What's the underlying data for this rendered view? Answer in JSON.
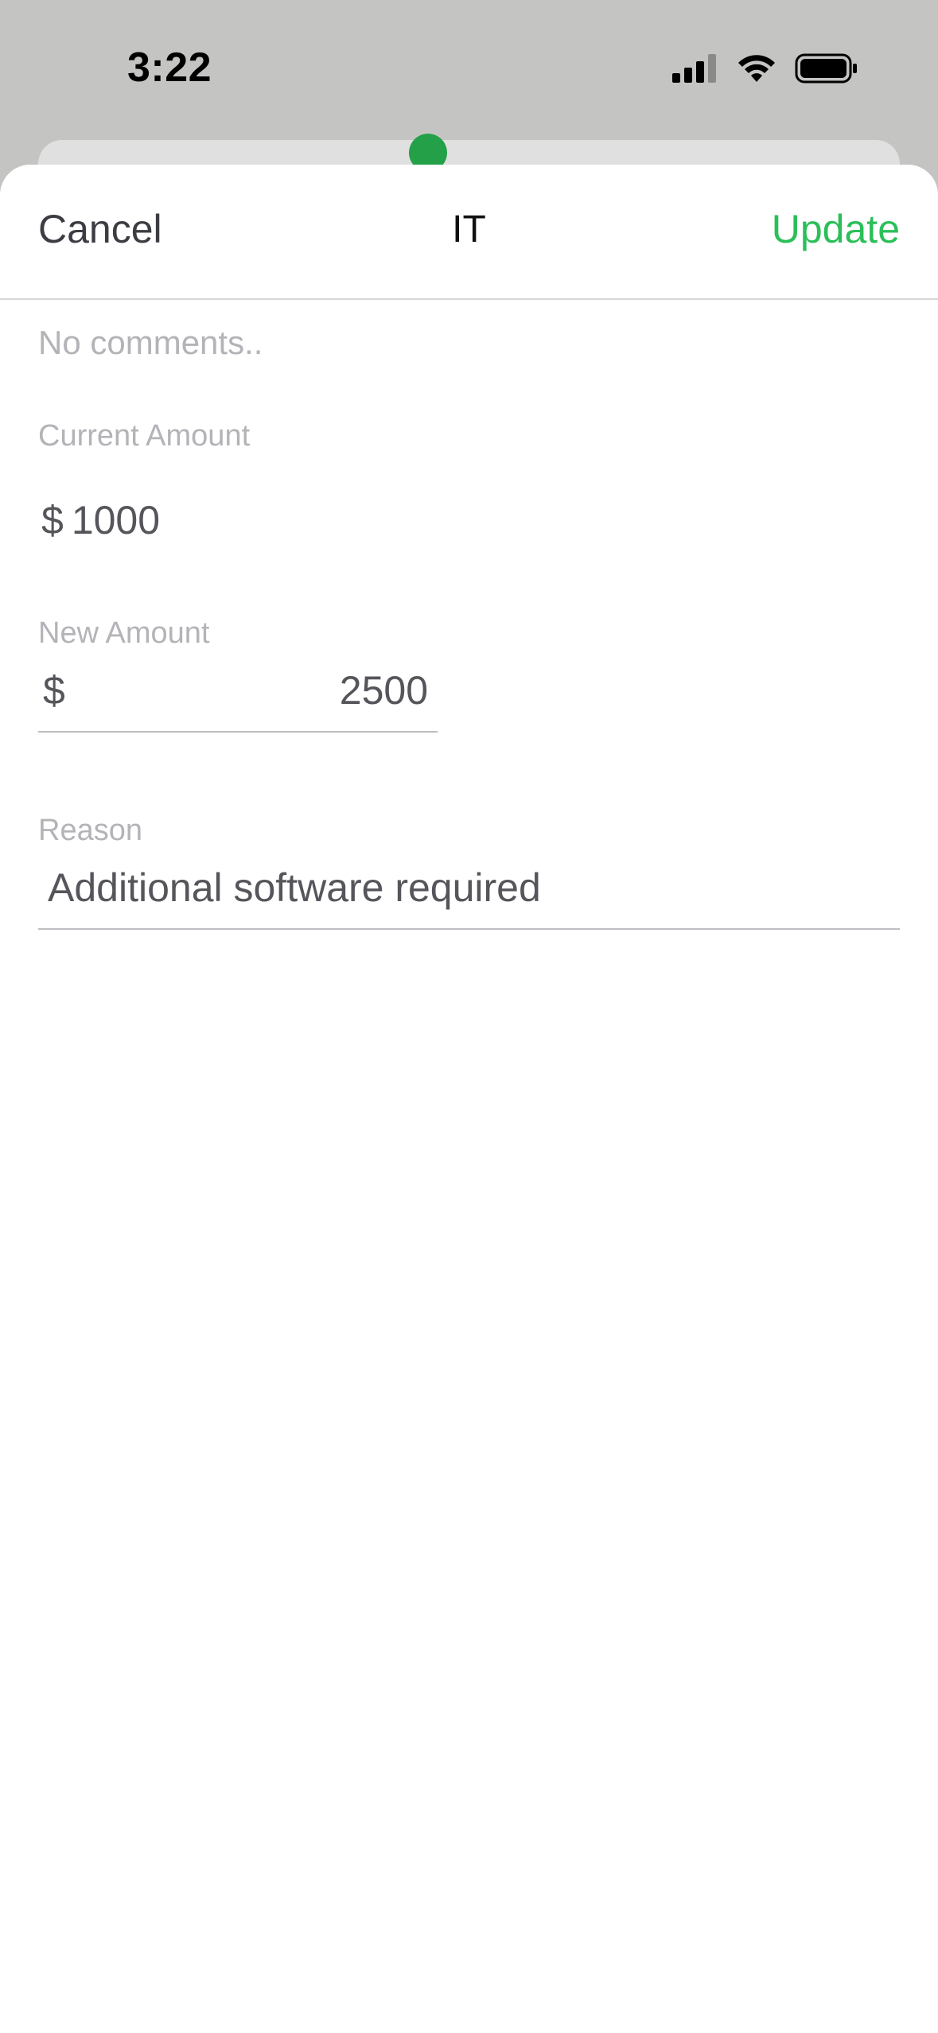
{
  "status_bar": {
    "time": "3:22",
    "icons": [
      "cellular-signal-icon",
      "wifi-icon",
      "battery-icon"
    ]
  },
  "nav": {
    "cancel_label": "Cancel",
    "title": "IT",
    "update_label": "Update"
  },
  "form": {
    "comments_placeholder": "No comments..",
    "current_amount": {
      "label": "Current Amount",
      "currency": "$",
      "value": "1000"
    },
    "new_amount": {
      "label": "New Amount",
      "currency": "$",
      "value": "2500"
    },
    "reason": {
      "label": "Reason",
      "value": "Additional software required"
    }
  },
  "colors": {
    "accent": "#2bbf58",
    "sheet_background": "#ffffff",
    "backdrop": "#c4c5c3"
  }
}
